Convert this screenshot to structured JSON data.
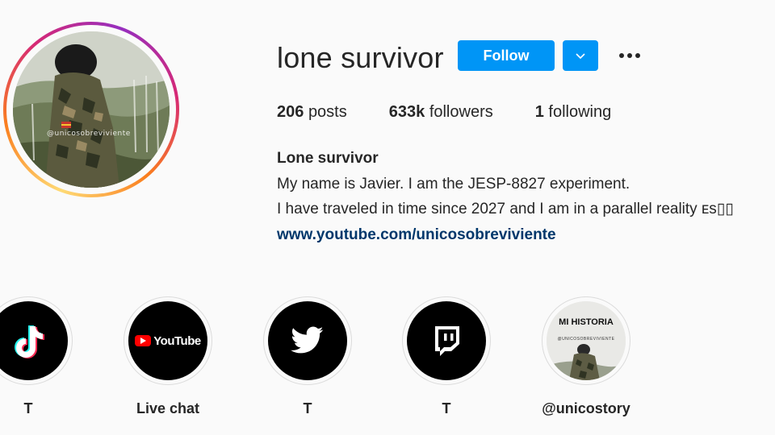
{
  "profile": {
    "username": "lone survivor",
    "avatar_watermark": "@unicosobreviviente",
    "follow_label": "Follow",
    "dropdown_icon": "chevron-down-icon",
    "more_icon": "more-horizontal-icon",
    "accent_color": "#0095f6"
  },
  "stats": {
    "posts_count": "206",
    "posts_label": "posts",
    "followers_count": "633k",
    "followers_label": "followers",
    "following_count": "1",
    "following_label": "following"
  },
  "bio": {
    "name": "Lone survivor",
    "line1": "My name is Javier. I am the JESP-8827 experiment.",
    "line2": "I have traveled in time since 2027 and I am in a parallel reality ᴇs▯▯",
    "link": "www.youtube.com/unicosobreviviente",
    "link_color": "#00376b"
  },
  "highlights": [
    {
      "label": "T",
      "icon": "tiktok-icon"
    },
    {
      "label": "Live chat",
      "icon": "youtube-icon",
      "logo_text": "YouTube"
    },
    {
      "label": "T",
      "icon": "twitter-icon"
    },
    {
      "label": "T",
      "icon": "twitch-icon"
    },
    {
      "label": "@unicostory",
      "icon": "mi-historia-cover",
      "cover_title": "MI HISTORIA",
      "cover_subtitle": "@UNICOSOBREVIVIENTE"
    }
  ]
}
